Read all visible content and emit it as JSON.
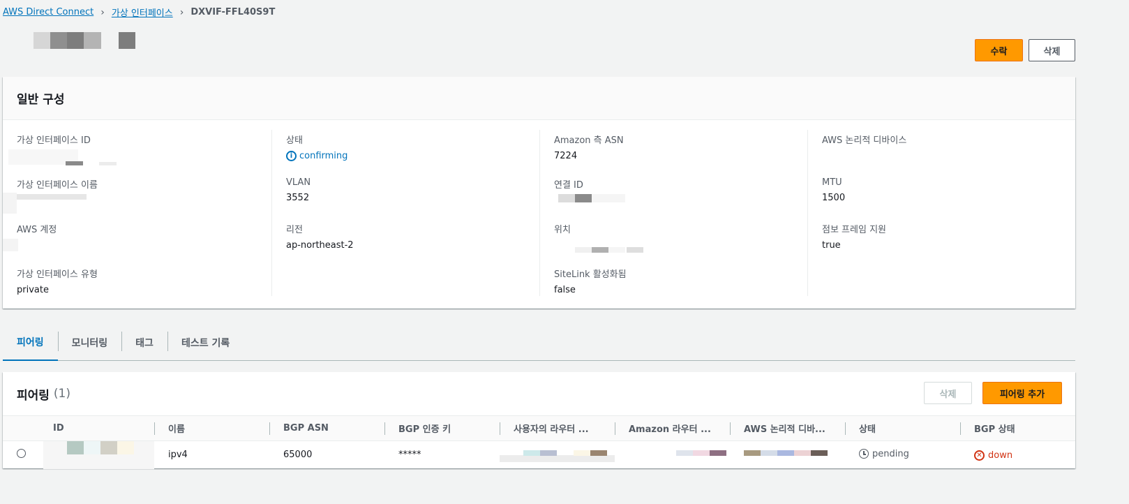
{
  "breadcrumb": {
    "link1": "AWS Direct Connect",
    "link2": "가상 인터페이스",
    "current": "DXVIF-FFL40S9T"
  },
  "header_buttons": {
    "accept": "수락",
    "delete": "삭제"
  },
  "general_config": {
    "title": "일반 구성",
    "fields": {
      "vif_id_label": "가상 인터페이스 ID",
      "vif_name_label": "가상 인터페이스 이름",
      "aws_account_label": "AWS 계정",
      "vif_type_label": "가상 인터페이스 유형",
      "vif_type_value": "private",
      "state_label": "상태",
      "state_value": "confirming",
      "vlan_label": "VLAN",
      "vlan_value": "3552",
      "region_label": "리전",
      "region_value": "ap-northeast-2",
      "amazon_asn_label": "Amazon 측 ASN",
      "amazon_asn_value": "7224",
      "connection_id_label": "연결 ID",
      "location_label": "위치",
      "sitelink_label": "SiteLink 활성화됨",
      "sitelink_value": "false",
      "aws_device_label": "AWS 논리적 디바이스",
      "mtu_label": "MTU",
      "mtu_value": "1500",
      "jumbo_label": "점보 프레임 지원",
      "jumbo_value": "true"
    }
  },
  "tabs": [
    "피어링",
    "모니터링",
    "태그",
    "테스트 기록"
  ],
  "peering": {
    "title": "피어링",
    "count": "(1)",
    "delete_label": "삭제",
    "add_label": "피어링 추가",
    "columns": [
      "ID",
      "이름",
      "BGP ASN",
      "BGP 인증 키",
      "사용자의 라우터 ...",
      "Amazon 라우터 ...",
      "AWS 논리적 디바...",
      "상태",
      "BGP 상태"
    ],
    "row": {
      "name": "ipv4",
      "bgp_asn": "65000",
      "auth_key": "*****",
      "state": "pending",
      "bgp_state": "down"
    }
  },
  "colors": {
    "accent": "#ff9900",
    "link": "#0073bb",
    "error": "#d13212"
  }
}
